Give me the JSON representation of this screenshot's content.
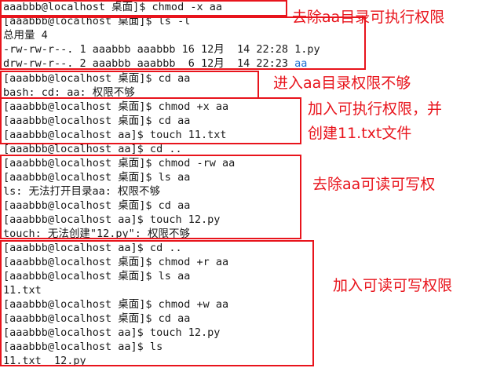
{
  "terminal": {
    "lines": [
      "aaabbb@localhost 桌面]$ chmod -x aa",
      "[aaabbb@localhost 桌面]$ ls -l",
      "总用量 4",
      "-rw-rw-r--. 1 aaabbb aaabbb 16 12月  14 22:28 1.py",
      "drw-rw-r--. 2 aaabbb aaabbb  6 12月  14 22:23 ",
      "[aaabbb@localhost 桌面]$ cd aa",
      "bash: cd: aa: 权限不够",
      "[aaabbb@localhost 桌面]$ chmod +x aa",
      "[aaabbb@localhost 桌面]$ cd aa",
      "[aaabbb@localhost aa]$ touch 11.txt",
      "[aaabbb@localhost aa]$ cd ..",
      "[aaabbb@localhost 桌面]$ chmod -rw aa",
      "[aaabbb@localhost 桌面]$ ls aa",
      "ls: 无法打开目录aa: 权限不够",
      "[aaabbb@localhost 桌面]$ cd aa",
      "[aaabbb@localhost aa]$ touch 12.py",
      "touch: 无法创建\"12.py\": 权限不够",
      "[aaabbb@localhost aa]$ cd ..",
      "[aaabbb@localhost 桌面]$ chmod +r aa",
      "[aaabbb@localhost 桌面]$ ls aa",
      "11.txt",
      "[aaabbb@localhost 桌面]$ chmod +w aa",
      "[aaabbb@localhost 桌面]$ cd aa",
      "[aaabbb@localhost aa]$ touch 12.py",
      "[aaabbb@localhost aa]$ ls",
      "11.txt  12.py"
    ],
    "dir_name": "aa",
    "dir_color": "#1f6fd1"
  },
  "annotations": [
    "去除aa目录可执行权限",
    "进入aa目录权限不够",
    "加入可执行权限，并",
    "创建11.txt文件",
    "去除aa可读可写权",
    "加入可读可写权限"
  ],
  "colors": {
    "annotation": "#e8141c",
    "text": "#1a1a1a",
    "background": "#ffffff"
  }
}
